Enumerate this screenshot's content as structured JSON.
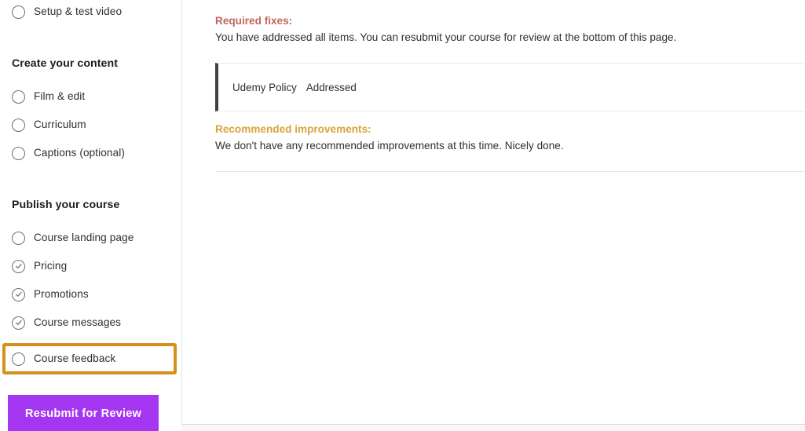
{
  "sidebar": {
    "top_item": {
      "label": "Setup & test video",
      "state": "incomplete"
    },
    "sections": [
      {
        "title": "Create your content",
        "items": [
          {
            "label": "Film & edit",
            "state": "incomplete"
          },
          {
            "label": "Curriculum",
            "state": "incomplete"
          },
          {
            "label": "Captions (optional)",
            "state": "incomplete"
          }
        ]
      },
      {
        "title": "Publish your course",
        "items": [
          {
            "label": "Course landing page",
            "state": "incomplete"
          },
          {
            "label": "Pricing",
            "state": "complete"
          },
          {
            "label": "Promotions",
            "state": "complete"
          },
          {
            "label": "Course messages",
            "state": "complete"
          },
          {
            "label": "Course feedback",
            "state": "incomplete",
            "highlighted": true
          }
        ]
      }
    ],
    "primary_button": {
      "label": "Resubmit for Review"
    }
  },
  "main": {
    "required_fixes": {
      "heading": "Required fixes:",
      "body": "You have addressed all items. You can resubmit your course for review at the bottom of this page.",
      "color": "#c0675b"
    },
    "policy_row": {
      "label": "Udemy Policy",
      "status": "Addressed"
    },
    "recommended_improvements": {
      "heading": "Recommended improvements:",
      "body": "We don't have any recommended improvements at this time. Nicely done.",
      "color": "#d9a43a"
    }
  },
  "colors": {
    "brand_purple": "#a435f0",
    "highlight_orange": "#d3911a",
    "accent_bar": "#3e4143"
  }
}
